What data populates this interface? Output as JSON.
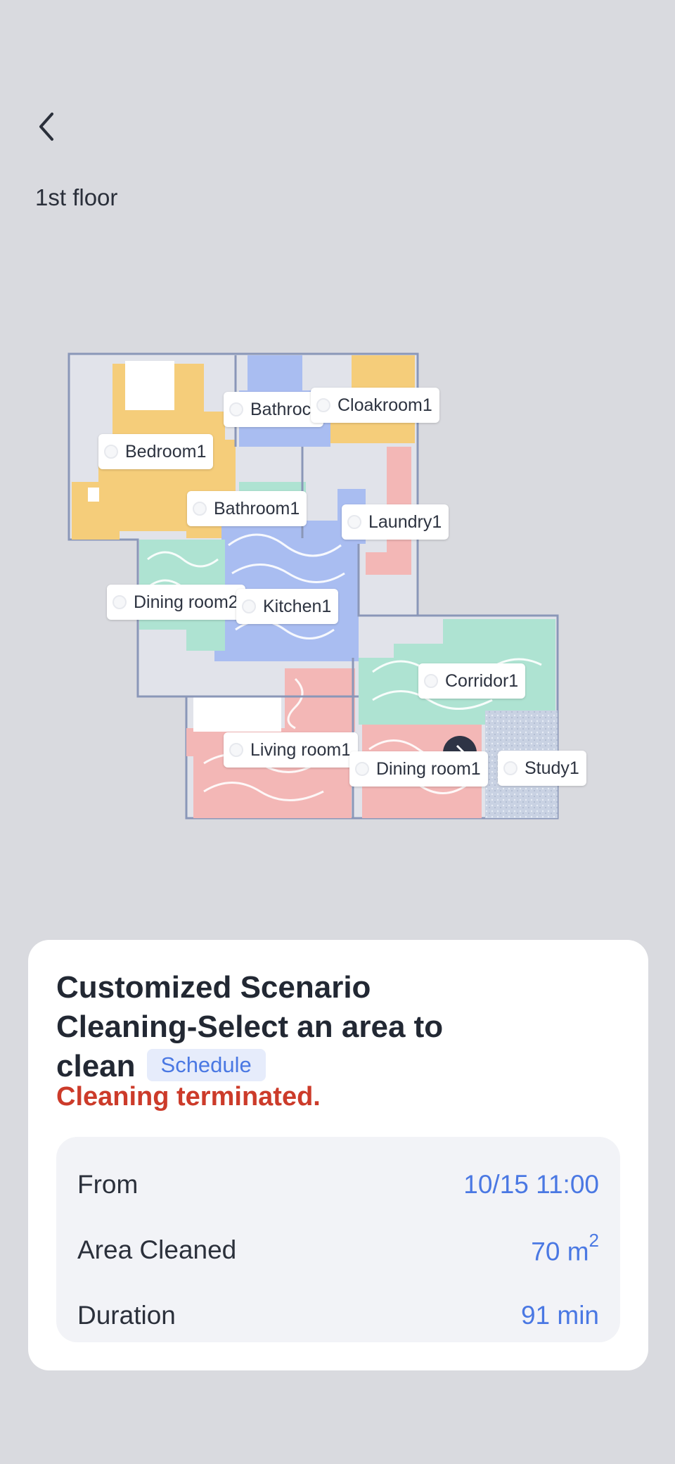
{
  "header": {
    "back_icon": "chevron-left-icon",
    "floor": "1st floor"
  },
  "map": {
    "rooms": [
      {
        "id": "bathroom-top",
        "label": "Bathroc"
      },
      {
        "id": "cloakroom",
        "label": "Cloakroom1"
      },
      {
        "id": "bedroom",
        "label": "Bedroom1"
      },
      {
        "id": "bathroom",
        "label": "Bathroom1"
      },
      {
        "id": "laundry",
        "label": "Laundry1"
      },
      {
        "id": "dining-room2",
        "label": "Dining room2"
      },
      {
        "id": "kitchen",
        "label": "Kitchen1"
      },
      {
        "id": "corridor",
        "label": "Corridor1"
      },
      {
        "id": "living-room",
        "label": "Living room1"
      },
      {
        "id": "dining-room1",
        "label": "Dining room1"
      },
      {
        "id": "study",
        "label": "Study1"
      }
    ],
    "colors": {
      "yellow": "#f5cd7a",
      "blue": "#a9bdf1",
      "green": "#aee3d2",
      "pink": "#f3b7b6",
      "gray": "#e1e3ea",
      "wall": "#8a97b8"
    }
  },
  "card": {
    "title": "Customized Scenario Cleaning-Select an area to clean",
    "badge": "Schedule",
    "status": "Cleaning terminated.",
    "stats": {
      "from_label": "From",
      "from_value": "10/15 11:00",
      "area_label": "Area Cleaned",
      "area_value": "70",
      "area_unit": "m",
      "area_exp": "2",
      "duration_label": "Duration",
      "duration_value": "91",
      "duration_unit": "min"
    }
  }
}
